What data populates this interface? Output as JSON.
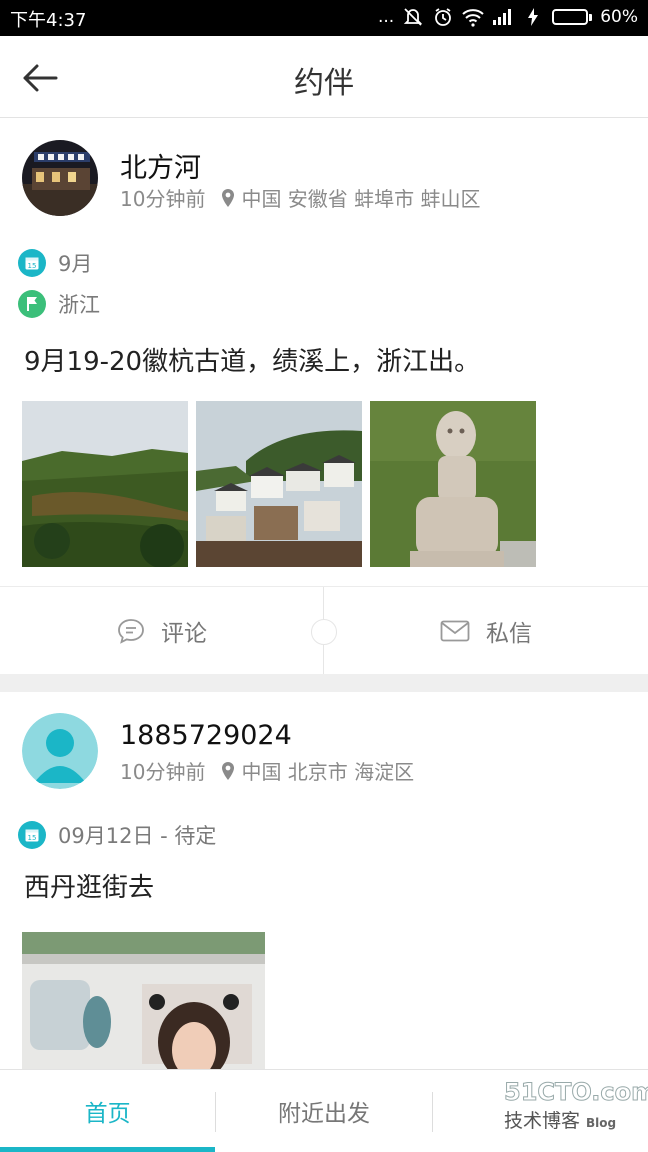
{
  "status_bar": {
    "time": "下午4:37",
    "signal_dots": "...",
    "battery_percent": "60%",
    "battery_level": 0.6
  },
  "header": {
    "title": "约伴",
    "back_icon": "arrow-left-icon"
  },
  "posts": [
    {
      "user": "北方河",
      "time_ago": "10分钟前",
      "location": "中国 安徽省 蚌埠市 蚌山区",
      "date": "9月",
      "destination": "浙江",
      "content": "9月19-20徽杭古道，绩溪上，浙江出。",
      "photos": [
        "hillside-photo",
        "village-photo",
        "stone-statue-photo"
      ],
      "comment_label": "评论",
      "message_label": "私信"
    },
    {
      "user": "1885729024",
      "time_ago": "10分钟前",
      "location": "中国 北京市 海淀区",
      "date": "09月12日 - 待定",
      "content": "西丹逛街去",
      "photos": [
        "street-photo"
      ]
    }
  ],
  "bottom_nav": {
    "tabs": [
      "首页",
      "附近出发"
    ],
    "active_tab": "首页"
  },
  "watermark": {
    "line1": "51CTO.com",
    "line2": "技术博客",
    "line3": "Blog"
  },
  "colors": {
    "accent": "#1bb6c7",
    "flag_green": "#3bbf7a",
    "separator": "#efefef"
  }
}
